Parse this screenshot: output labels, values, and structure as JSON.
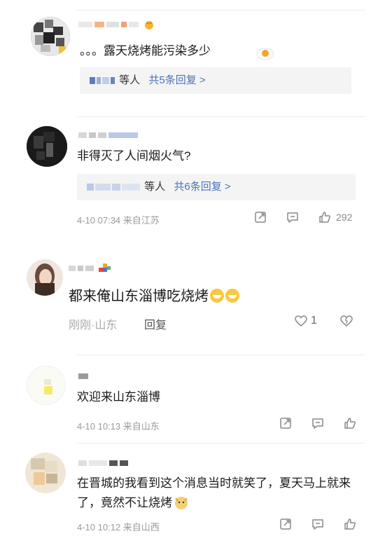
{
  "comments": [
    {
      "text": "。。。露天烧烤能污染多少",
      "reply": {
        "suffix": "等人",
        "link": "共5条回复 >"
      }
    },
    {
      "text": "非得灭了人间烟火气?",
      "reply": {
        "suffix": "等人",
        "link": "共6条回复 >"
      },
      "meta": "4-10 07:34 来自江苏",
      "likes": "292"
    },
    {
      "text": "都来俺山东淄博吃烧烤",
      "meta": "刚刚·山东",
      "reply_label": "回复",
      "likes": "1"
    },
    {
      "text": "欢迎来山东淄博",
      "meta": "4-10 10:13 来自山东"
    },
    {
      "text": "在晋城的我看到这个消息当时就笑了，夏天马上就来了，竟然不让烧烤",
      "meta": "4-10 10:12 来自山西"
    }
  ],
  "icons": [
    "share-icon",
    "comment-icon",
    "like-icon",
    "heart-icon",
    "dislike-icon",
    "emoji-grin-icon",
    "emoji-dog-icon",
    "fried-egg-icon",
    "crown-badge-icon"
  ]
}
